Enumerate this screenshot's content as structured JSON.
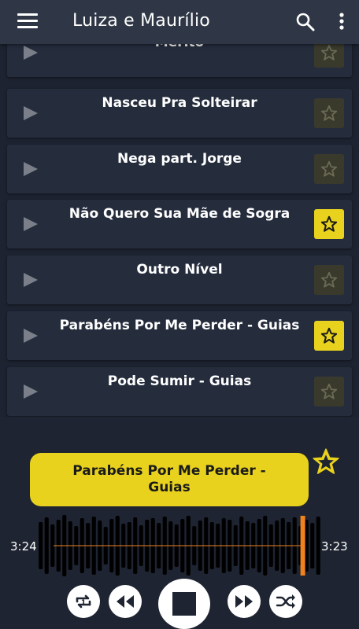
{
  "app": {
    "title": "Luiza e Maurílio",
    "icons": {
      "menu": "hamburger-menu-icon",
      "search": "search-icon",
      "more": "more-vert-icon"
    }
  },
  "songs": [
    {
      "title": "Mérito",
      "favorite": false
    },
    {
      "title": "Nasceu Pra Solteirar",
      "favorite": false
    },
    {
      "title": "Nega part. Jorge",
      "favorite": false
    },
    {
      "title": "Não Quero Sua Mãe de Sogra",
      "favorite": true
    },
    {
      "title": "Outro Nível",
      "favorite": false
    },
    {
      "title": "Parabéns Por Me Perder - Guias",
      "favorite": true
    },
    {
      "title": "Pode Sumir - Guias",
      "favorite": false
    }
  ],
  "player": {
    "now_playing": "Parabéns Por Me Perder - Guias",
    "favorite": true,
    "elapsed": "3:24",
    "total": "3:23",
    "progress": 0.99,
    "controls": [
      "repeat-one-icon",
      "rewind-icon",
      "stop-icon",
      "fast-forward-icon",
      "shuffle-icon"
    ]
  },
  "colors": {
    "accent": "#e8d21d",
    "background": "#1d2331",
    "card": "#252d3d",
    "appbar": "#2f3746",
    "progress_marker": "#f0821e"
  }
}
